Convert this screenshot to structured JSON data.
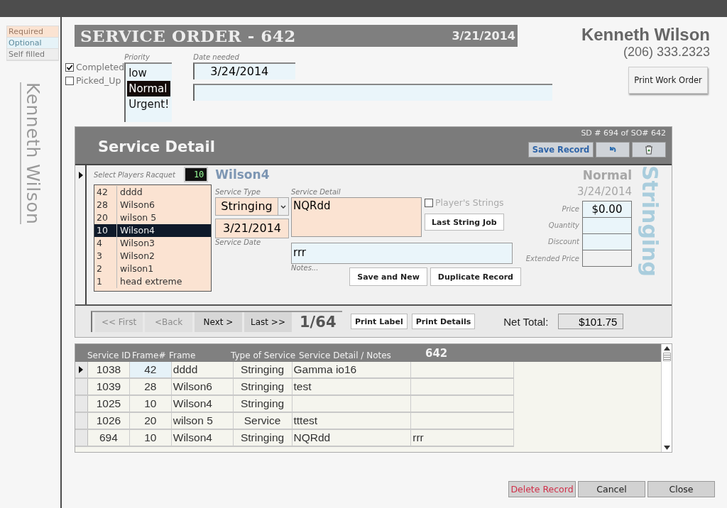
{
  "legend": [
    {
      "label": "Required",
      "kind": "required"
    },
    {
      "label": "Optional",
      "kind": "optional"
    },
    {
      "label": "Self filled",
      "kind": "self"
    }
  ],
  "customer_vertical": "Kenneth Wilson",
  "customer": {
    "name": "Kenneth Wilson",
    "phone": "(206) 333.2323"
  },
  "order": {
    "title": "SERVICE ORDER - 642",
    "date": "3/21/2014"
  },
  "print_work_order": "Print Work Order",
  "checkboxes": [
    {
      "label": "Completed",
      "checked": true
    },
    {
      "label": "Picked_Up",
      "checked": false
    }
  ],
  "priority": {
    "label": "Priority",
    "options": [
      {
        "label": "low",
        "selected": false
      },
      {
        "label": "Normal",
        "selected": true
      },
      {
        "label": "Urgent!",
        "selected": false
      }
    ]
  },
  "date_needed": {
    "label": "Date needed",
    "value": "3/24/2014"
  },
  "detail": {
    "title": "Service Detail",
    "record_info": "SD # 694 of SO# 642",
    "save": "Save Record",
    "racquet_label": "Select Players Racquet",
    "racquet_number": "10",
    "racquet_name": "Wilson4",
    "racquets": [
      {
        "number": "42",
        "name": "dddd",
        "selected": false
      },
      {
        "number": "28",
        "name": "Wilson6",
        "selected": false
      },
      {
        "number": "20",
        "name": "wilson 5",
        "selected": false
      },
      {
        "number": "10",
        "name": "Wilson4",
        "selected": true
      },
      {
        "number": "4",
        "name": "Wilson3",
        "selected": false
      },
      {
        "number": "3",
        "name": "Wilson2",
        "selected": false
      },
      {
        "number": "2",
        "name": "wilson1",
        "selected": false
      },
      {
        "number": "1",
        "name": "head extreme",
        "selected": false
      }
    ],
    "service_type": {
      "label": "Service Type",
      "value": "Stringing"
    },
    "service_date": {
      "label": "Service Date",
      "value": "3/21/2014"
    },
    "service_detail": {
      "label": "Service Detail",
      "value": "NQRdd"
    },
    "notes": {
      "label": "Notes...",
      "value": "rrr"
    },
    "players_strings": {
      "label": "Player's Strings",
      "checked": false
    },
    "last_string_job": "Last String Job",
    "save_and_new": "Save and New",
    "duplicate": "Duplicate Record",
    "priority_display": "Normal",
    "date_display": "3/24/2014",
    "type_display": "Stringing",
    "pricing": [
      {
        "label": "Price",
        "value": "$0.00"
      },
      {
        "label": "Quantity"
      },
      {
        "label": "Discount"
      },
      {
        "label": "Extended Price"
      }
    ]
  },
  "nav": [
    {
      "label": "<< First",
      "disabled": true
    },
    {
      "label": "<Back",
      "disabled": true
    },
    {
      "label": "Next >",
      "disabled": false
    },
    {
      "label": "Last >>",
      "disabled": false
    }
  ],
  "position": "1/64",
  "print_label": "Print Label",
  "print_details": "Print Details",
  "net_total_label": "Net Total:",
  "net_total": "$101.75",
  "table": {
    "columns": [
      "Service ID",
      "Frame#",
      "Frame",
      "Type of Service",
      "Service Detail  / Notes"
    ],
    "order_number": "642",
    "rows": [
      {
        "current": true,
        "service_id": "1038",
        "frame_no": "42",
        "frame": "dddd",
        "type": "Stringing",
        "detail": "Gamma io16"
      },
      {
        "current": false,
        "service_id": "1039",
        "frame_no": "28",
        "frame": "Wilson6",
        "type": "Stringing",
        "detail": "test"
      },
      {
        "current": false,
        "service_id": "1025",
        "frame_no": "10",
        "frame": "Wilson4",
        "type": "Stringing"
      },
      {
        "current": false,
        "service_id": "1026",
        "frame_no": "20",
        "frame": "wilson 5",
        "type": "Service",
        "detail": "tttest"
      },
      {
        "current": false,
        "service_id": "694",
        "frame_no": "10",
        "frame": "Wilson4",
        "type": "Stringing",
        "detail": "NQRdd",
        "notes": "rrr"
      }
    ]
  },
  "bottom_buttons": [
    {
      "label": "Delete Record",
      "kind": "danger"
    },
    {
      "label": "Cancel",
      "kind": "normal"
    },
    {
      "label": "Close",
      "kind": "normal"
    }
  ]
}
